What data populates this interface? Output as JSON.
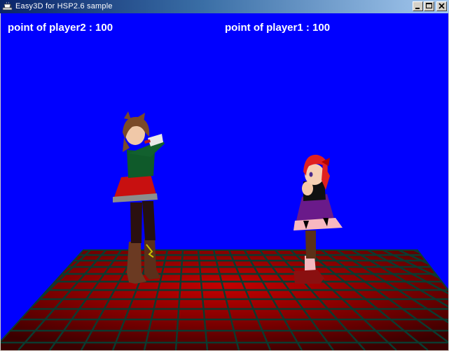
{
  "window": {
    "title": "Easy3D for HSP2.6 sample",
    "icon": "teacup-app-icon",
    "controls": [
      "minimize-icon",
      "maximize-icon",
      "close-icon"
    ]
  },
  "hud": {
    "player2": {
      "label": "point of player2",
      "points": 100,
      "text": "point of player2 : 100"
    },
    "player1": {
      "label": "point of player1",
      "points": 100,
      "text": "point of player1 : 100"
    }
  },
  "scene": {
    "background_color": "#0000ff",
    "floor": "red checkered grid floor with dark green grid lines",
    "characters": [
      {
        "id": "player2",
        "hair": "brown",
        "outfit": "green top, red skirt with gray hem, brown boots",
        "pose": "hands raised to face"
      },
      {
        "id": "player1",
        "hair": "red with red bow",
        "outfit": "purple skirt with pink hem, black top, pink boots",
        "pose": "hands together at chest"
      }
    ]
  },
  "colors": {
    "titlebar_start": "#0a246a",
    "titlebar_end": "#a6caf0",
    "hud_text": "#ffffff",
    "floor_red": "#b00000",
    "grid_line": "#0a3a2a"
  }
}
